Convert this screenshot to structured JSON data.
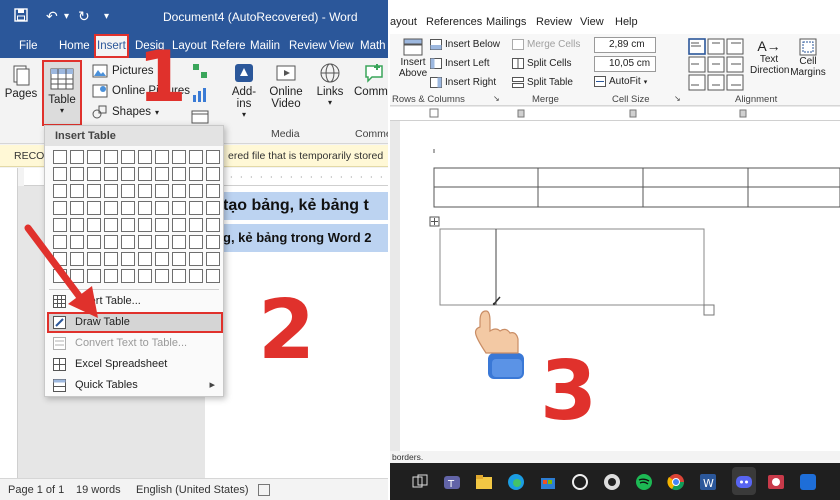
{
  "left": {
    "window_title": "Document4 (AutoRecovered)  -  Word",
    "tabs": [
      "File",
      "Home",
      "Insert",
      "Desig",
      "Layout",
      "Refere",
      "Mailin",
      "Review",
      "View",
      "Math"
    ],
    "ribbon": {
      "pages": "Pages",
      "table": "Table",
      "pictures": "Pictures",
      "online_pictures": "Online Pictures",
      "shapes": "Shapes",
      "addins": "Add-ins",
      "online_video": "Online Video",
      "media_group": "Media",
      "links": "Links",
      "comment": "Comme"
    },
    "recover_bar": {
      "prefix": "RECOV",
      "text": "ered file that is temporarily stored"
    },
    "doc_lines": [
      "tạo bảng, kẻ bảng t",
      "g, kẻ bảng trong Word 2"
    ],
    "dropdown": {
      "header": "Insert Table",
      "grid_rows": 8,
      "grid_cols": 10,
      "items": [
        {
          "label": "Insert Table...",
          "state": "normal",
          "icon": "insert-table-icon"
        },
        {
          "label": "Draw Table",
          "state": "highlight",
          "icon": "pencil-icon"
        },
        {
          "label": "Convert Text to Table...",
          "state": "disabled",
          "icon": "convert-icon"
        },
        {
          "label": "Excel Spreadsheet",
          "state": "normal",
          "icon": "excel-icon"
        },
        {
          "label": "Quick Tables",
          "state": "normal",
          "icon": "quick-tables-icon",
          "submenu": true
        }
      ]
    },
    "status": {
      "page": "Page 1 of 1",
      "words": "19 words",
      "language": "English (United States)"
    },
    "step_numbers": [
      "1",
      "2"
    ]
  },
  "right": {
    "tabs": [
      "ayout",
      "References",
      "Mailings",
      "Review",
      "View",
      "Help"
    ],
    "rows_cols": {
      "insert_above": "Insert Above",
      "insert_below": "Insert Below",
      "insert_left": "Insert Left",
      "insert_right": "Insert Right",
      "group_label": "Rows & Columns"
    },
    "merge": {
      "merge_cells": "Merge Cells",
      "split_cells": "Split Cells",
      "split_table": "Split Table",
      "group_label": "Merge"
    },
    "cell_size": {
      "height": "2,89 cm",
      "width": "10,05 cm",
      "autofit": "AutoFit",
      "group_label": "Cell Size"
    },
    "alignment": {
      "text_direction": "Text Direction",
      "cell_margins": "Cell Margins",
      "group_label": "Alignment"
    },
    "status": "borders.",
    "step_number": "3"
  },
  "colors": {
    "word_blue": "#2b579a",
    "annotation_red": "#e0312c",
    "selection_blue": "#bcd3f1"
  }
}
